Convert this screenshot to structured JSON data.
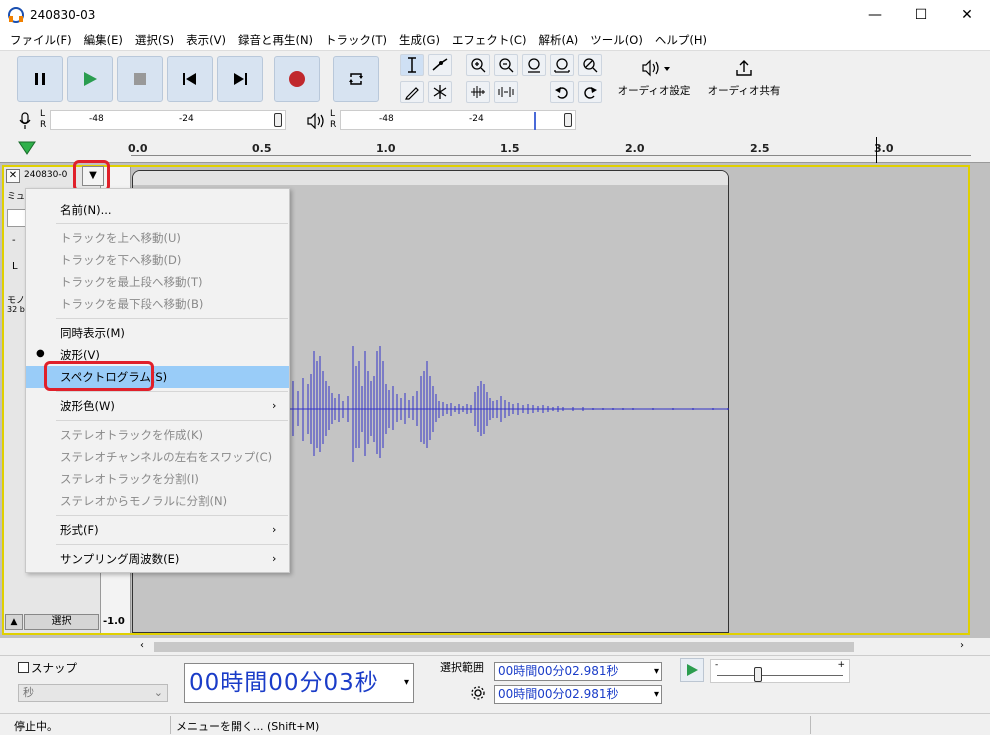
{
  "window": {
    "title": "240830-03",
    "minimize": "—",
    "maximize": "☐",
    "close": "✕"
  },
  "menubar": [
    "ファイル(F)",
    "編集(E)",
    "選択(S)",
    "表示(V)",
    "録音と再生(N)",
    "トラック(T)",
    "生成(G)",
    "エフェクト(C)",
    "解析(A)",
    "ツール(O)",
    "ヘルプ(H)"
  ],
  "toolbar": {
    "audio_settings": "オーディオ設定",
    "share_audio": "オーディオ共有"
  },
  "meters": {
    "rec_ticks": [
      "-48",
      "-24"
    ],
    "play_ticks": [
      "-48",
      "-24"
    ],
    "lr": [
      "L",
      "R"
    ]
  },
  "timeline": {
    "ticks": [
      "0.0",
      "0.5",
      "1.0",
      "1.5",
      "2.0",
      "2.5",
      "3.0"
    ]
  },
  "track": {
    "name": "240830-0",
    "mute": "ミュ",
    "mono_label": "モノ",
    "bit_label": "32 b",
    "select_label": "選択",
    "scale_min": "-1.0"
  },
  "menu": {
    "items": [
      {
        "label": "名前(N)...",
        "disabled": false
      },
      {
        "label": "トラックを上へ移動(U)",
        "disabled": true
      },
      {
        "label": "トラックを下へ移動(D)",
        "disabled": true
      },
      {
        "label": "トラックを最上段へ移動(T)",
        "disabled": true
      },
      {
        "label": "トラックを最下段へ移動(B)",
        "disabled": true
      },
      {
        "label": "同時表示(M)",
        "disabled": false
      },
      {
        "label": "波形(V)",
        "disabled": false,
        "checked": true
      },
      {
        "label": "スペクトログラム(S)",
        "disabled": false,
        "highlighted": true
      },
      {
        "label": "波形色(W)",
        "disabled": false,
        "submenu": true
      },
      {
        "label": "ステレオトラックを作成(K)",
        "disabled": true
      },
      {
        "label": "ステレオチャンネルの左右をスワップ(C)",
        "disabled": true
      },
      {
        "label": "ステレオトラックを分割(I)",
        "disabled": true
      },
      {
        "label": "ステレオからモノラルに分割(N)",
        "disabled": true
      },
      {
        "label": "形式(F)",
        "disabled": false,
        "submenu": true
      },
      {
        "label": "サンプリング周波数(E)",
        "disabled": false,
        "submenu": true
      }
    ]
  },
  "bottom": {
    "snap_label": "スナップ",
    "snap_unit": "秒",
    "time_display": "00時間00分03秒",
    "selection_label": "選択範囲",
    "sel_start": "00時間00分02.981秒",
    "sel_end": "00時間00分02.981秒",
    "speed_ticks": [
      "-",
      "+"
    ]
  },
  "status": {
    "left": "停止中。",
    "right": "メニューを開く... (Shift+M)"
  },
  "colors": {
    "waveform": "#3232c8",
    "highlight": "#99ccf8",
    "track_border": "#e0d000",
    "annotation": "#e0202a",
    "time_text": "#1a3cc8"
  }
}
